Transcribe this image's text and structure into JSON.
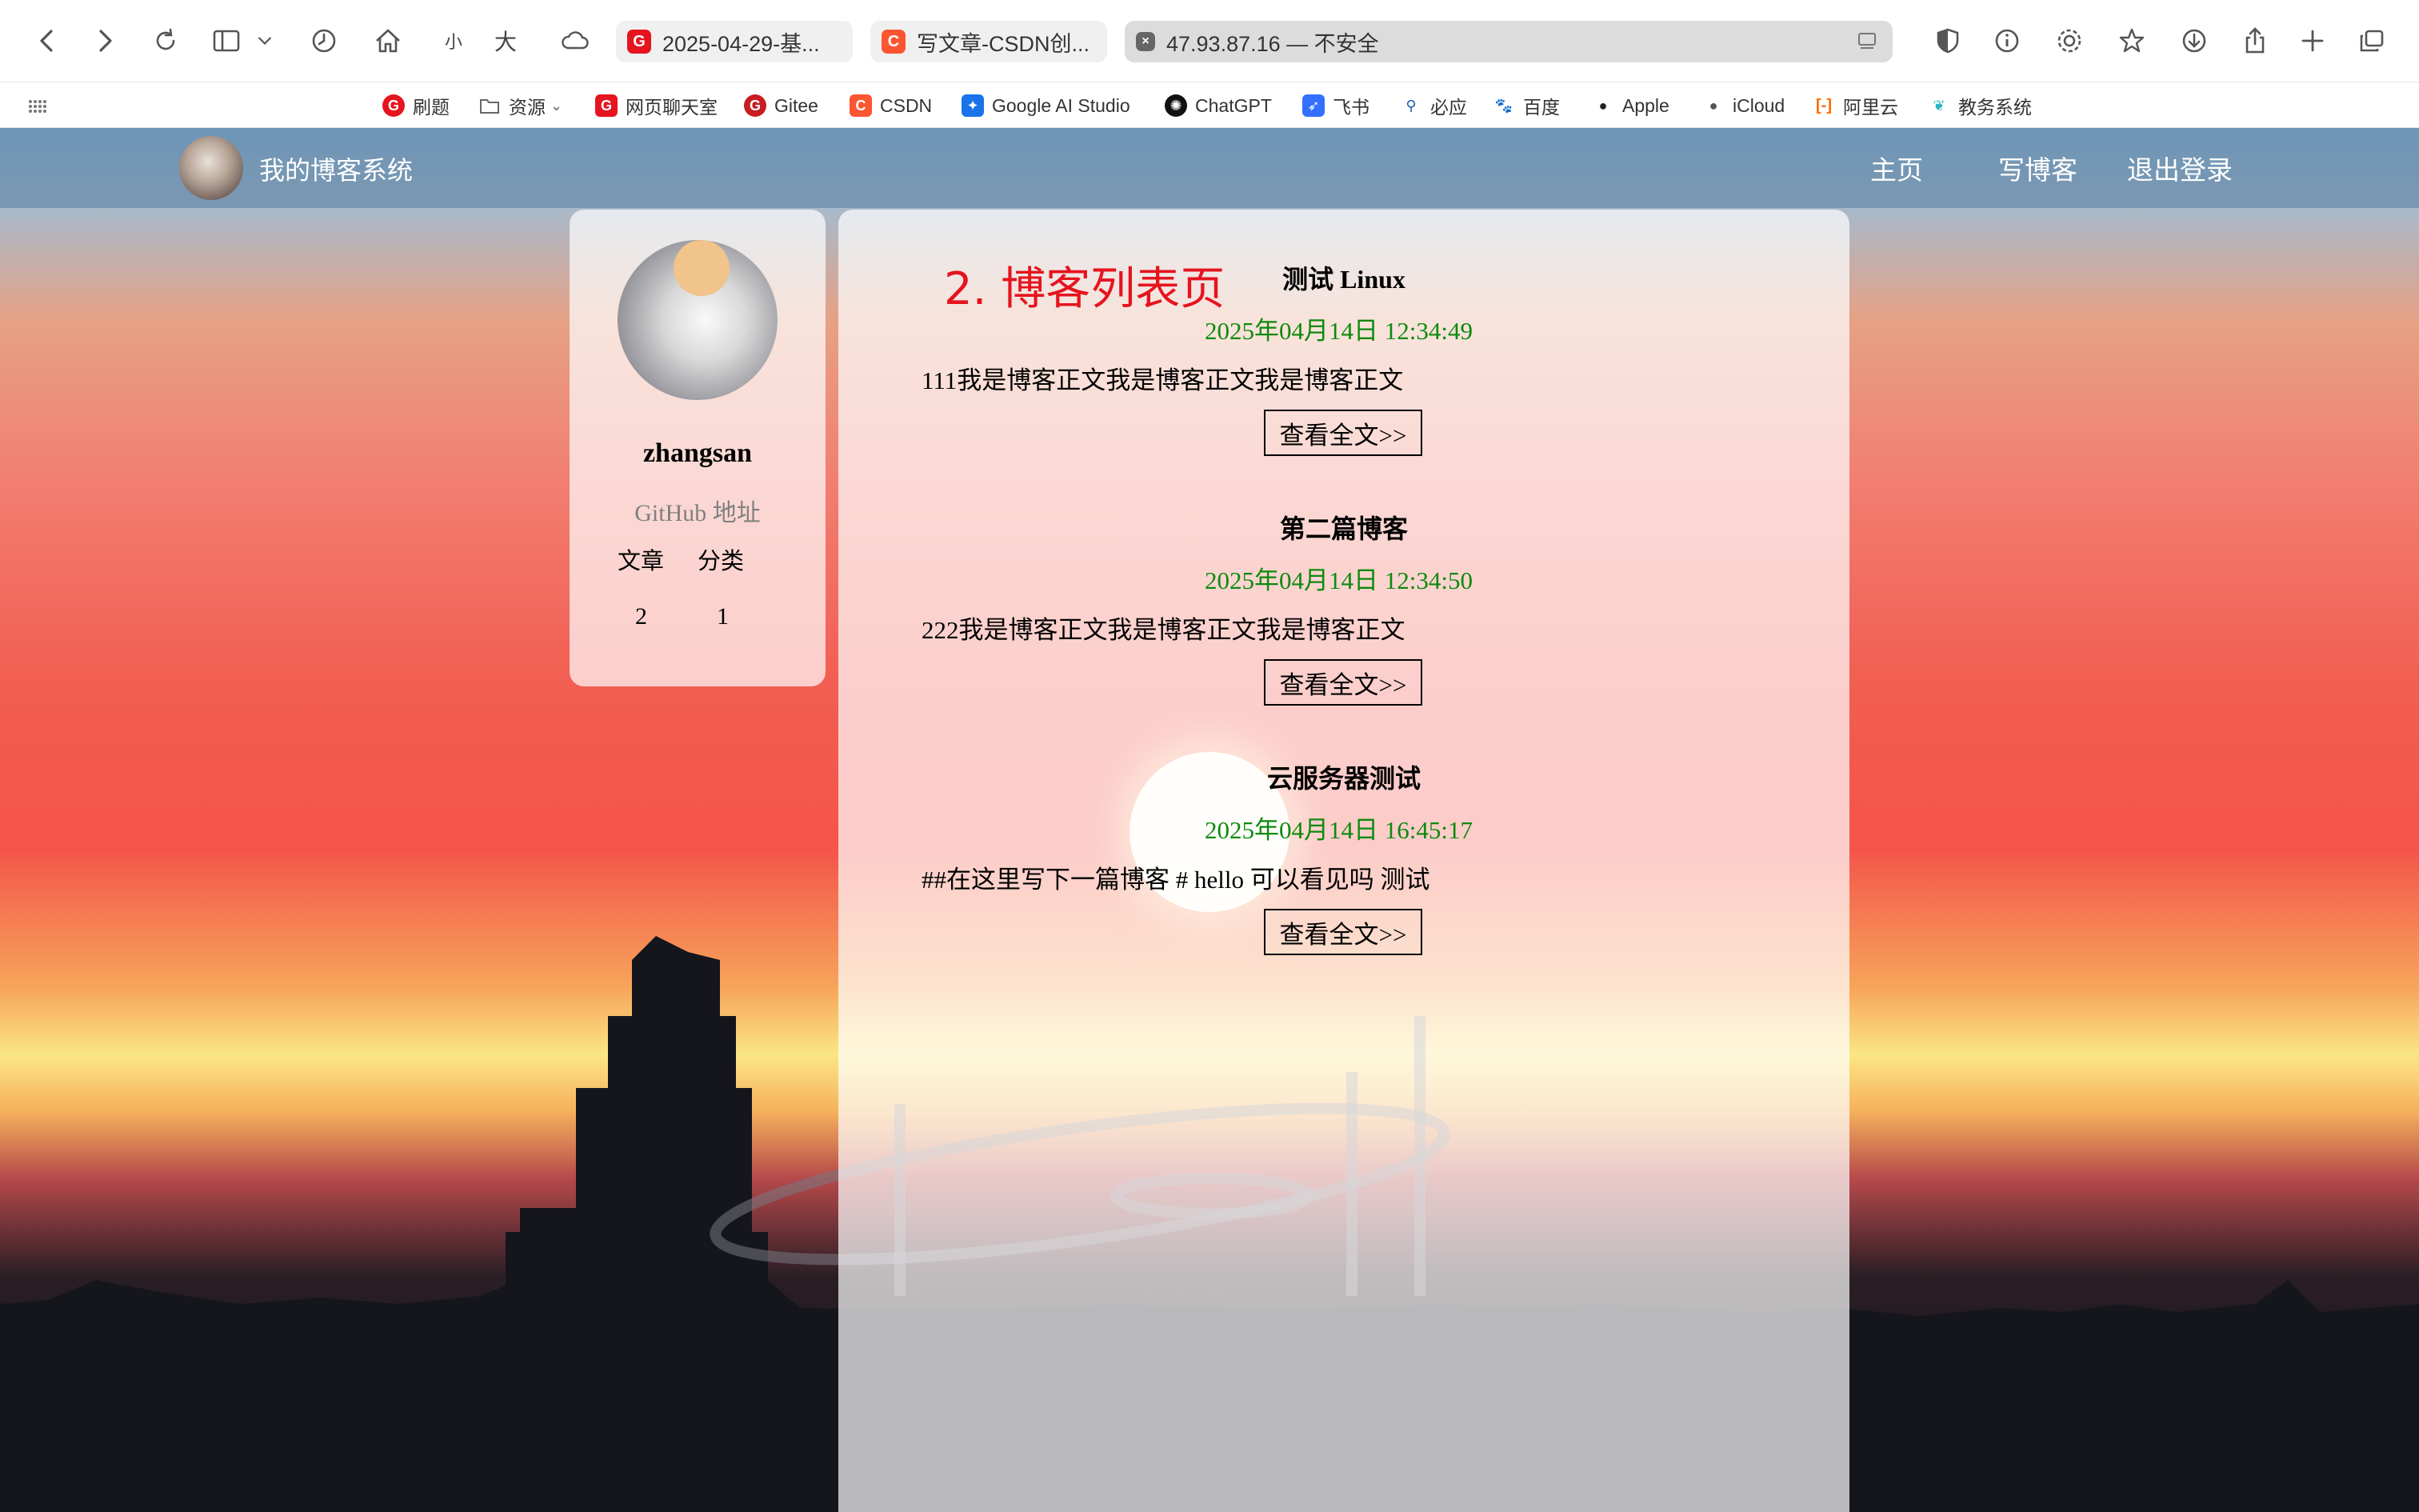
{
  "browser": {
    "font_small": "小",
    "font_large": "大",
    "tabs": [
      {
        "label": "2025-04-29-基...",
        "color": "#e5141e"
      },
      {
        "label": "写文章-CSDN创...",
        "color": "#fc5531"
      },
      {
        "label": "47.93.87.16 — 不安全",
        "color": "#555555"
      }
    ],
    "bookmarks": [
      {
        "label": "刷题"
      },
      {
        "label": "资源"
      },
      {
        "label": "网页聊天室"
      },
      {
        "label": "Gitee"
      },
      {
        "label": "CSDN"
      },
      {
        "label": "Google AI Studio"
      },
      {
        "label": "ChatGPT"
      },
      {
        "label": "飞书"
      },
      {
        "label": "必应"
      },
      {
        "label": "百度"
      },
      {
        "label": "Apple"
      },
      {
        "label": "iCloud"
      },
      {
        "label": "阿里云"
      },
      {
        "label": "教务系统"
      }
    ]
  },
  "navbar": {
    "title": "我的博客系统",
    "links": [
      "主页",
      "写博客",
      "退出登录"
    ]
  },
  "user": {
    "name": "zhangsan",
    "github": "GitHub 地址",
    "articles_label": "文章",
    "categories_label": "分类",
    "articles_count": "2",
    "categories_count": "1"
  },
  "annotation": "2. 博客列表页",
  "blogs": [
    {
      "title": "测试 Linux",
      "date": "2025年04月14日 12:34:49",
      "desc": "111我是博客正文我是博客正文我是博客正文",
      "button": "查看全文>>"
    },
    {
      "title": "第二篇博客",
      "date": "2025年04月14日 12:34:50",
      "desc": "222我是博客正文我是博客正文我是博客正文",
      "button": "查看全文>>"
    },
    {
      "title": "云服务器测试",
      "date": "2025年04月14日 16:45:17",
      "desc": "##在这里写下一篇博客 # hello 可以看见吗 测试",
      "button": "查看全文>>"
    }
  ],
  "colors": {
    "date_green": "#0d8a0d",
    "annotation_red": "#e5141e"
  }
}
